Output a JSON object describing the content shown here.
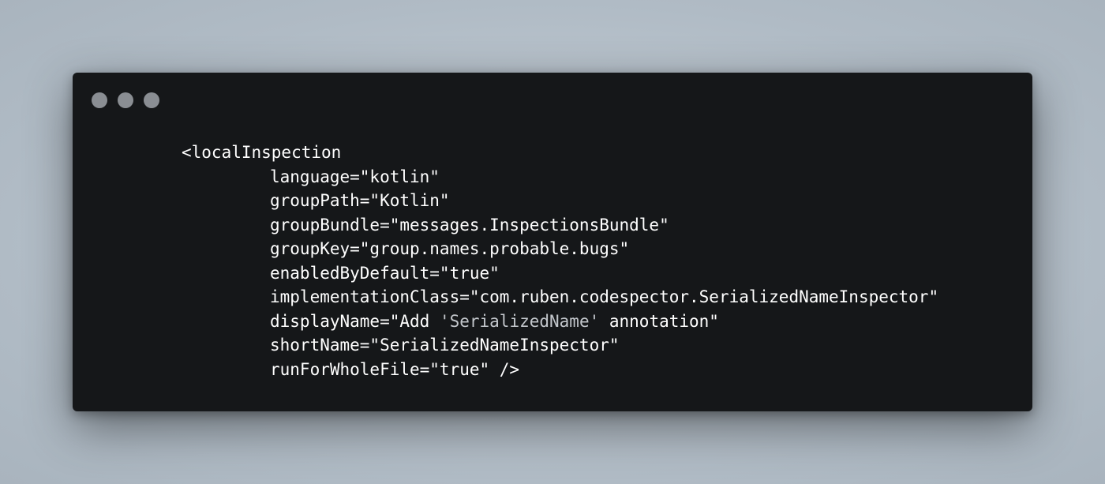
{
  "window": {
    "controls": [
      "close",
      "minimize",
      "zoom"
    ]
  },
  "code": {
    "open_tag": "<localInspection",
    "attributes": [
      "language=\"kotlin\"",
      "groupPath=\"Kotlin\"",
      "groupBundle=\"messages.InspectionsBundle\"",
      "groupKey=\"group.names.probable.bugs\"",
      "enabledByDefault=\"true\"",
      "implementationClass=\"com.ruben.codespector.SerializedNameInspector\""
    ],
    "display_name": {
      "prefix": "displayName=\"Add ",
      "quoted": "'SerializedName'",
      "suffix": " annotation\""
    },
    "short_name": "shortName=\"SerializedNameInspector\"",
    "last_line": "runForWholeFile=\"true\" />"
  }
}
